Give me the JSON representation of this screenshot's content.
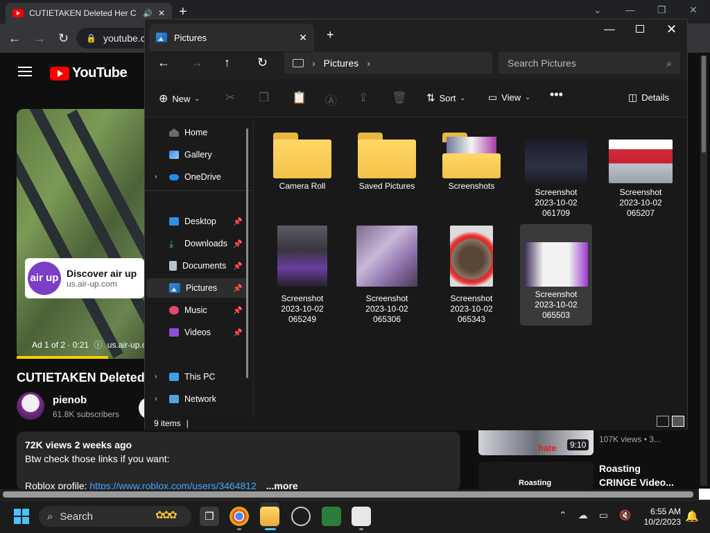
{
  "browser": {
    "tab_title": "CUTIETAKEN Deleted Her C",
    "url": "youtube.co"
  },
  "youtube": {
    "logo_text": "YouTube",
    "ad": {
      "logo_text": "air up",
      "title": "Discover air up",
      "url": "us.air-up.com",
      "info": "Ad 1 of 2 · 0:21",
      "info_url": "us.air-up.c",
      "progress": 0.66
    },
    "video_title": "CUTIETAKEN Deleted",
    "channel": {
      "name": "pienob",
      "subscribers": "61.8K subscribers"
    },
    "description": {
      "stats": "72K views  2 weeks ago",
      "line1": "Btw check those links if you want:",
      "link_prefix": "Roblox profile: ",
      "link_url": "https://www.roblox.com/users/3464812",
      "more": "...more"
    },
    "related": [
      {
        "duration": "9:10",
        "overlay_text": "hate",
        "meta": "107K views  •  3..."
      },
      {
        "overlay_text": "Roasting",
        "title_line1": "Roasting",
        "title_line2": "CRINGE Video..."
      }
    ]
  },
  "explorer": {
    "tab_label": "Pictures",
    "address": {
      "segment": "Pictures"
    },
    "search_placeholder": "Search Pictures",
    "commands": {
      "new": "New",
      "sort": "Sort",
      "view": "View",
      "details": "Details"
    },
    "nav": {
      "home": "Home",
      "gallery": "Gallery",
      "onedrive": "OneDrive",
      "desktop": "Desktop",
      "downloads": "Downloads",
      "documents": "Documents",
      "pictures": "Pictures",
      "music": "Music",
      "videos": "Videos",
      "this_pc": "This PC",
      "network": "Network"
    },
    "items": {
      "camera_roll": "Camera Roll",
      "saved_pictures": "Saved Pictures",
      "screenshots": "Screenshots",
      "s1": {
        "l1": "Screenshot",
        "l2": "2023-10-02",
        "l3": "061709"
      },
      "s2": {
        "l1": "Screenshot",
        "l2": "2023-10-02",
        "l3": "065207"
      },
      "s3": {
        "l1": "Screenshot",
        "l2": "2023-10-02",
        "l3": "065249"
      },
      "s4": {
        "l1": "Screenshot",
        "l2": "2023-10-02",
        "l3": "065306"
      },
      "s5": {
        "l1": "Screenshot",
        "l2": "2023-10-02",
        "l3": "065343"
      },
      "s6": {
        "l1": "Screenshot",
        "l2": "2023-10-02",
        "l3": "065503"
      }
    },
    "status": "9 items"
  },
  "taskbar": {
    "search": "Search",
    "time": "6:55 AM",
    "date": "10/2/2023"
  }
}
